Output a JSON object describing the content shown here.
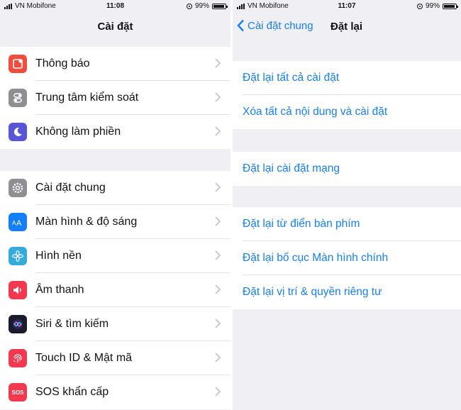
{
  "left": {
    "status": {
      "carrier": "VN Mobifone",
      "time": "11:08",
      "battery": "99%"
    },
    "nav": {
      "title": "Cài đặt"
    },
    "group1": [
      {
        "label": "Thông báo",
        "icon": "notification-icon",
        "color": "#f24c3d"
      },
      {
        "label": "Trung tâm kiểm soát",
        "icon": "control-center-icon",
        "color": "#8e8e93"
      },
      {
        "label": "Không làm phiền",
        "icon": "moon-icon",
        "color": "#5856d6"
      }
    ],
    "group2": [
      {
        "label": "Cài đặt chung",
        "icon": "gear-icon",
        "color": "#8e8e93"
      },
      {
        "label": "Màn hình & độ sáng",
        "icon": "text-size-icon",
        "color": "#157efb"
      },
      {
        "label": "Hình nền",
        "icon": "wallpaper-icon",
        "color": "#35aadc"
      },
      {
        "label": "Âm thanh",
        "icon": "speaker-icon",
        "color": "#f2394f"
      },
      {
        "label": "Siri & tìm kiếm",
        "icon": "siri-icon",
        "color": "#1b1b2e"
      },
      {
        "label": "Touch ID & Mật mã",
        "icon": "fingerprint-icon",
        "color": "#f2394f"
      },
      {
        "label": "SOS khẩn cấp",
        "icon": "sos-icon",
        "color": "#f2394f",
        "icon_text": "SOS"
      }
    ]
  },
  "right": {
    "status": {
      "carrier": "VN Mobifone",
      "time": "11:07",
      "battery": "99%"
    },
    "nav": {
      "back": "Cài đặt chung",
      "title": "Đặt lại"
    },
    "group1": [
      "Đặt lại tất cả cài đặt",
      "Xóa tất cả nội dung và cài đặt"
    ],
    "group2": [
      "Đặt lại cài đặt mạng"
    ],
    "group3": [
      "Đặt lại từ điển bàn phím",
      "Đặt lại bố cục Màn hình chính",
      "Đặt lại vị trí & quyền riêng tư"
    ]
  },
  "colors": {
    "accent": "#157efb",
    "background": "#efeff4"
  }
}
